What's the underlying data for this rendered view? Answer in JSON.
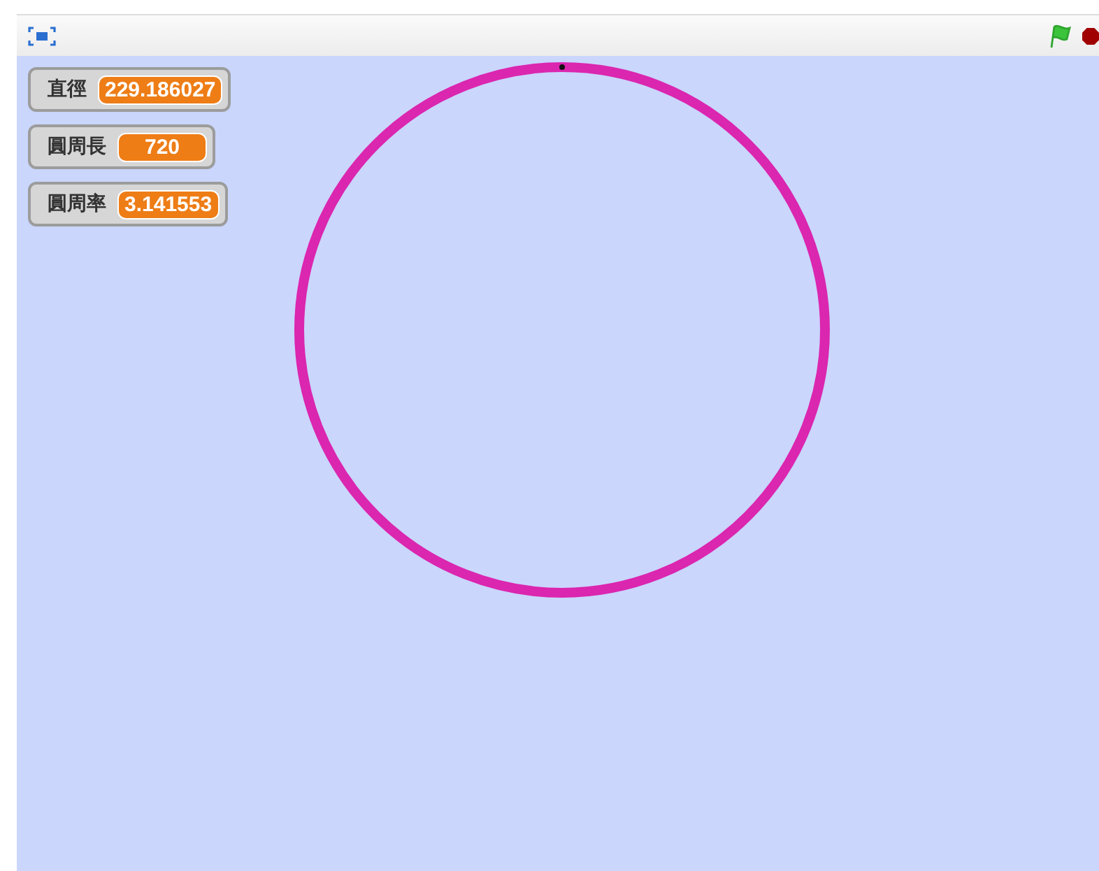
{
  "monitors": [
    {
      "label": "直徑",
      "value": "229.186027"
    },
    {
      "label": "圓周長",
      "value": "720"
    },
    {
      "label": "圓周率",
      "value": "3.141553"
    }
  ]
}
